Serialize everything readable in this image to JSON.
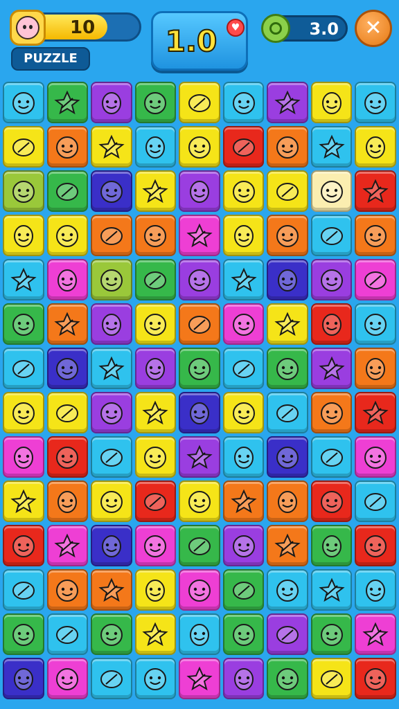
{
  "hud": {
    "level_value": "10",
    "level_progress": 0.75,
    "mode_label": "PUZZLE",
    "score_value": "1.0",
    "coins_value": "3.0",
    "close_glyph": "✕",
    "icons": {
      "avatar": "face-icon",
      "heart": "heart-icon",
      "coin": "leaf-coin-icon",
      "close": "close-icon"
    }
  },
  "board": {
    "columns": 9,
    "rows": 14,
    "palette": {
      "C": "#2fc2ee",
      "G": "#36b84a",
      "P": "#9a3ee0",
      "Y": "#f5e418",
      "O": "#f4781a",
      "R": "#e8281c",
      "M": "#ee3fd4",
      "B": "#3a2fc8",
      "L": "#9ac83a",
      "W": "#fbeeb0"
    },
    "tiles": [
      [
        "C",
        "G",
        "P",
        "G",
        "Y",
        "C",
        "P",
        "Y",
        "C"
      ],
      [
        "Y",
        "O",
        "Y",
        "C",
        "Y",
        "R",
        "O",
        "C",
        "Y"
      ],
      [
        "L",
        "G",
        "B",
        "Y",
        "P",
        "Y",
        "Y",
        "W",
        "R"
      ],
      [
        "Y",
        "Y",
        "O",
        "O",
        "M",
        "Y",
        "O",
        "C",
        "O"
      ],
      [
        "C",
        "M",
        "L",
        "G",
        "P",
        "C",
        "B",
        "P",
        "M"
      ],
      [
        "G",
        "O",
        "P",
        "Y",
        "O",
        "M",
        "Y",
        "R",
        "C"
      ],
      [
        "C",
        "B",
        "C",
        "P",
        "G",
        "C",
        "G",
        "P",
        "O"
      ],
      [
        "Y",
        "Y",
        "P",
        "Y",
        "B",
        "Y",
        "C",
        "O",
        "R"
      ],
      [
        "M",
        "R",
        "C",
        "Y",
        "P",
        "C",
        "B",
        "C",
        "M"
      ],
      [
        "Y",
        "O",
        "Y",
        "R",
        "Y",
        "O",
        "O",
        "R",
        "C"
      ],
      [
        "R",
        "M",
        "B",
        "M",
        "G",
        "P",
        "O",
        "G",
        "R"
      ],
      [
        "C",
        "O",
        "O",
        "Y",
        "M",
        "G",
        "C",
        "C",
        "C"
      ],
      [
        "G",
        "C",
        "G",
        "Y",
        "C",
        "G",
        "P",
        "G",
        "M"
      ],
      [
        "B",
        "M",
        "C",
        "C",
        "M",
        "P",
        "G",
        "Y",
        "R"
      ]
    ]
  }
}
